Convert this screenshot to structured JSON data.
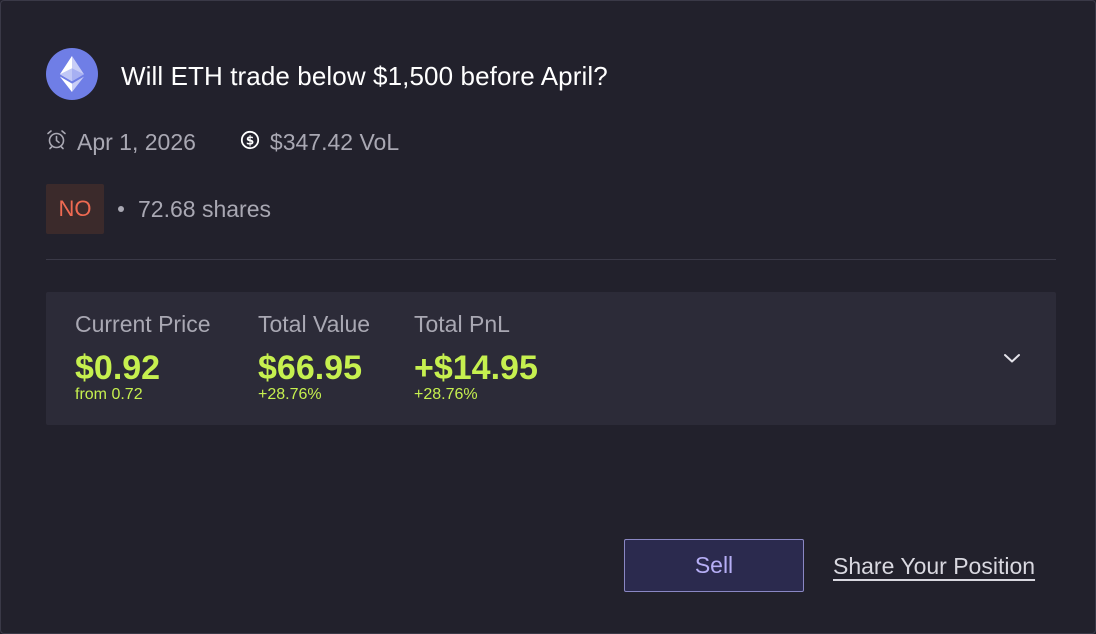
{
  "market": {
    "title": "Will ETH trade below $1,500 before April?",
    "end_date": "Apr 1, 2026",
    "volume": "$347.42 VoL"
  },
  "position": {
    "side": "NO",
    "shares": "72.68 shares"
  },
  "stats": {
    "current_price": {
      "label": "Current Price",
      "value": "$0.92",
      "sub": "from 0.72"
    },
    "total_value": {
      "label": "Total Value",
      "value": "$66.95",
      "sub": "+28.76%"
    },
    "total_pnl": {
      "label": "Total PnL",
      "value": "+$14.95",
      "sub": "+28.76%"
    }
  },
  "actions": {
    "sell_label": "Sell",
    "share_label": "Share Your Position"
  },
  "colors": {
    "background": "#22212c",
    "panel": "#2c2b38",
    "positive": "#c6f04f",
    "no_badge_text": "#ef6a52",
    "no_badge_bg": "#3b2a2b",
    "eth_logo": "#6f7ee6",
    "sell_button_bg": "#2b2a4e",
    "sell_button_text": "#b6aef5"
  },
  "icons": {
    "logo": "ethereum-logo-icon",
    "end_date": "alarm-clock-icon",
    "volume": "dollar-coin-icon",
    "expand": "chevron-down-icon"
  }
}
